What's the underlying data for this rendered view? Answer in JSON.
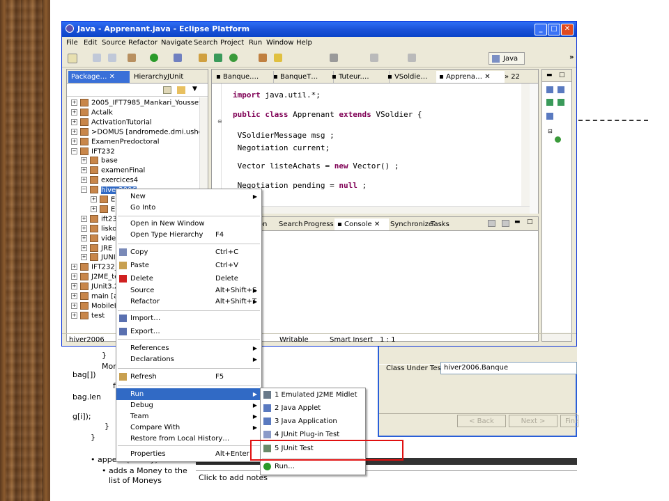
{
  "window": {
    "title": "Java - Apprenant.java - Eclipse Platform"
  },
  "menubar": [
    "File",
    "Edit",
    "Source",
    "Refactor",
    "Navigate",
    "Search",
    "Project",
    "Run",
    "Window",
    "Help"
  ],
  "perspective": {
    "label": "Java"
  },
  "left_panel": {
    "tabs": [
      "Package…",
      "Hierarchy",
      "JUnit"
    ],
    "tree": [
      {
        "label": "2005_IFT7985_Mankari_Youssef"
      },
      {
        "label": "Actalk"
      },
      {
        "label": "ActivationTutorial"
      },
      {
        "label": ">DOMUS  [andromede.dmi.usherb."
      },
      {
        "label": "ExamenPredoctoral"
      },
      {
        "label": "IFT232"
      },
      {
        "label": "base"
      },
      {
        "label": "examenFinal"
      },
      {
        "label": "exercices4"
      },
      {
        "label": "hiver2006"
      },
      {
        "label": "E"
      },
      {
        "label": "E"
      },
      {
        "label": "ift23"
      },
      {
        "label": "liskov"
      },
      {
        "label": "video"
      },
      {
        "label": "JRE"
      },
      {
        "label": "JUNI"
      },
      {
        "label": "IFT232_"
      },
      {
        "label": "J2ME_te"
      },
      {
        "label": "JUnit3.2"
      },
      {
        "label": "main  [a"
      },
      {
        "label": "MobileLe"
      },
      {
        "label": "test"
      }
    ]
  },
  "editor": {
    "tabs": [
      "Banque.…",
      "BanqueT…",
      "Tuteur.…",
      "VSoldie…",
      "Apprena…",
      "22"
    ],
    "code": [
      {
        "parts": [
          {
            "kw": true,
            "t": "import"
          },
          {
            "kw": false,
            "t": " java.util.*;"
          }
        ]
      },
      {
        "parts": [
          {
            "kw": true,
            "t": "public class"
          },
          {
            "kw": false,
            "t": " Apprenant "
          },
          {
            "kw": true,
            "t": "extends"
          },
          {
            "kw": false,
            "t": " VSoldier {"
          }
        ]
      },
      {
        "parts": [
          {
            "kw": false,
            "t": " VSoldierMessage msg ;"
          }
        ]
      },
      {
        "parts": [
          {
            "kw": false,
            "t": " Negotiation current;"
          }
        ]
      },
      {
        "parts": [
          {
            "kw": false,
            "t": " Vector listeAchats = "
          },
          {
            "kw": true,
            "t": "new"
          },
          {
            "kw": false,
            "t": " Vector() ;"
          }
        ]
      },
      {
        "parts": [
          {
            "kw": false,
            "t": " Negotiation pending = "
          },
          {
            "kw": true,
            "t": "null"
          },
          {
            "kw": false,
            "t": " ;"
          }
        ]
      }
    ]
  },
  "console": {
    "tabs": [
      "ation",
      "Search",
      "Progress",
      "Console",
      "Synchronize",
      "Tasks"
    ]
  },
  "statusbar": {
    "left": "hiver2006",
    "writable": "Writable",
    "insert": "Smart Insert",
    "position": "1 : 1"
  },
  "context_menu": {
    "items": [
      {
        "label": "New",
        "shortcut": "",
        "submenu": true
      },
      {
        "label": "Go Into",
        "shortcut": "",
        "submenu": false
      },
      {
        "label": "Open in New Window",
        "shortcut": "",
        "submenu": false
      },
      {
        "label": "Open Type Hierarchy",
        "shortcut": "F4",
        "submenu": false
      },
      {
        "label": "Copy",
        "shortcut": "Ctrl+C",
        "submenu": false
      },
      {
        "label": "Paste",
        "shortcut": "Ctrl+V",
        "submenu": false
      },
      {
        "label": "Delete",
        "shortcut": "Delete",
        "submenu": false
      },
      {
        "label": "Source",
        "shortcut": "Alt+Shift+S",
        "submenu": true
      },
      {
        "label": "Refactor",
        "shortcut": "Alt+Shift+T",
        "submenu": true
      },
      {
        "label": "Import…",
        "shortcut": "",
        "submenu": false
      },
      {
        "label": "Export…",
        "shortcut": "",
        "submenu": false
      },
      {
        "label": "References",
        "shortcut": "",
        "submenu": true
      },
      {
        "label": "Declarations",
        "shortcut": "",
        "submenu": true
      },
      {
        "label": "Refresh",
        "shortcut": "F5",
        "submenu": false
      },
      {
        "label": "Run",
        "shortcut": "",
        "submenu": true
      },
      {
        "label": "Debug",
        "shortcut": "",
        "submenu": true
      },
      {
        "label": "Team",
        "shortcut": "",
        "submenu": true
      },
      {
        "label": "Compare With",
        "shortcut": "",
        "submenu": true
      },
      {
        "label": "Restore from Local History…",
        "shortcut": "",
        "submenu": false
      },
      {
        "label": "Properties",
        "shortcut": "Alt+Enter",
        "submenu": false
      }
    ]
  },
  "run_submenu": {
    "items": [
      {
        "label": "1 Emulated J2ME Midlet"
      },
      {
        "label": "2 Java Applet"
      },
      {
        "label": "3 Java Application"
      },
      {
        "label": "4 JUnit Plug-in Test"
      },
      {
        "label": "5 JUnit Test"
      },
      {
        "label": "Run…"
      }
    ]
  },
  "dialog": {
    "class_under_test_label": "Class Under Test:",
    "class_under_test_value": "hiver2006.Banque",
    "back": "< Back",
    "next": "Next >",
    "finish": "Finis"
  },
  "slide": {
    "code_lines": [
      "}",
      "Mon",
      "bag[])",
      "f",
      "bag.len",
      "g[i]);",
      "}",
      "}"
    ],
    "bullet1": "append(Money)",
    "bullet2_line1": "adds a Money to the",
    "bullet2_line2": "list of Moneys",
    "notes": "Click to add notes"
  },
  "colors": {
    "highlight": "#316ac5",
    "title_bar": "#0a44c9",
    "keyword": "#7f0055",
    "annotation_box": "#e01010"
  }
}
